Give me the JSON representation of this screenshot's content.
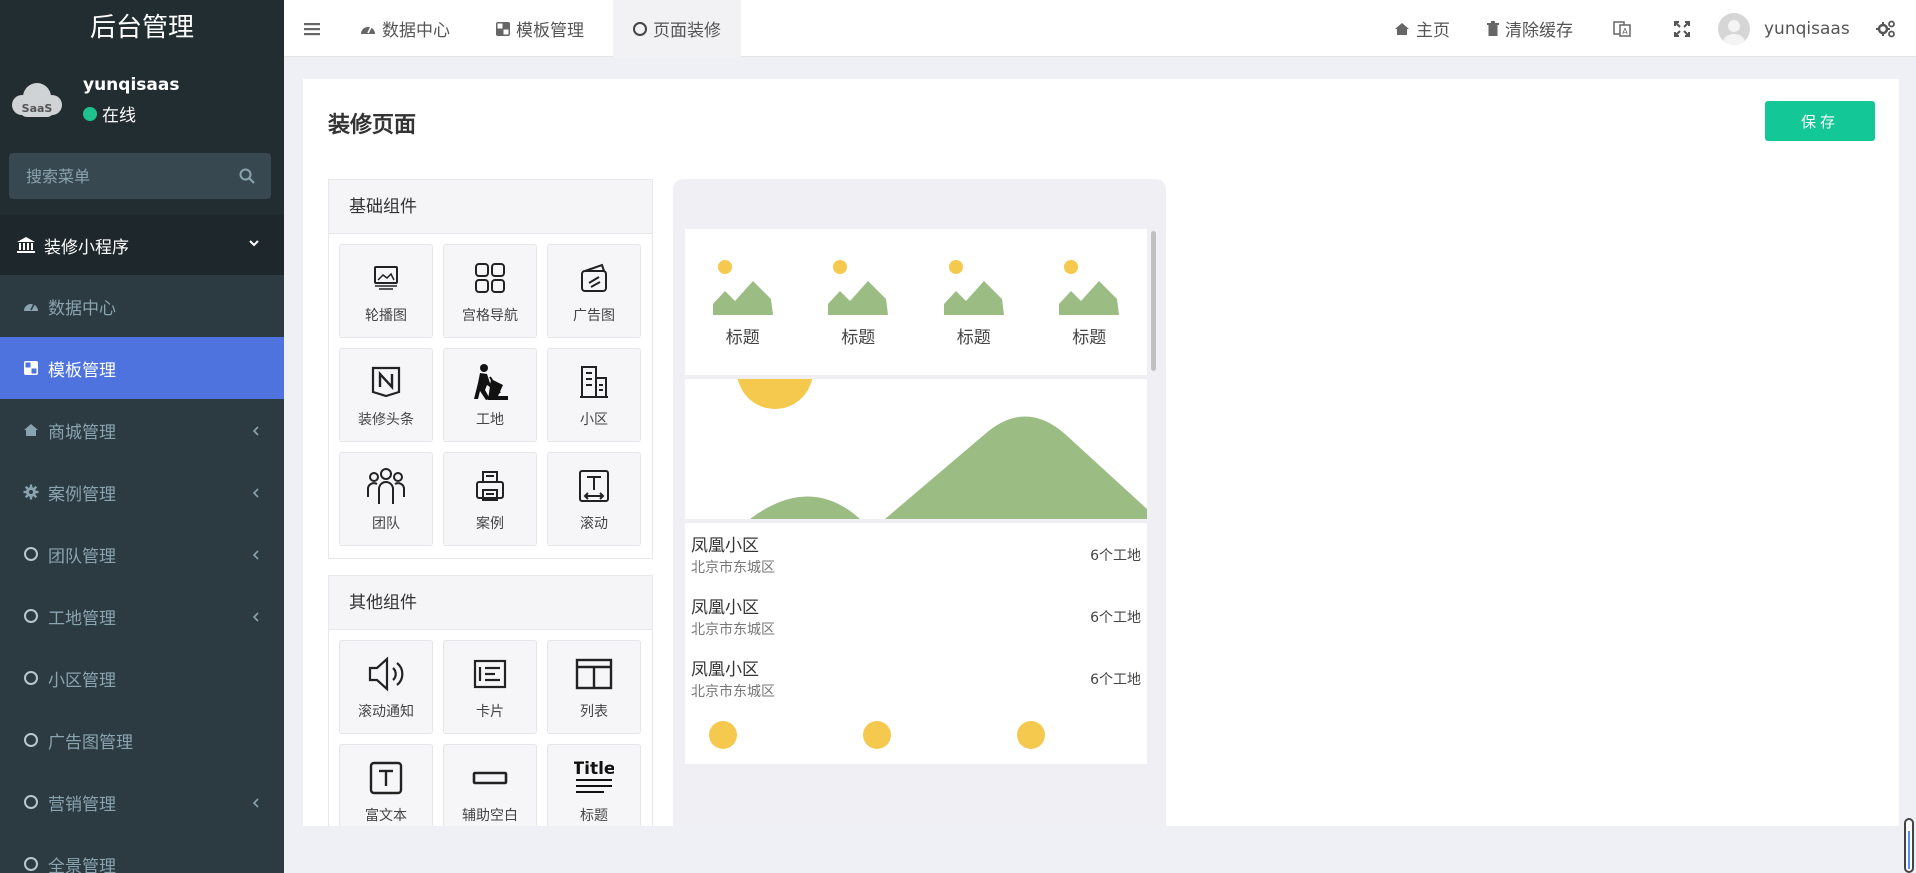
{
  "sidebar": {
    "logo": "后台管理",
    "avatar_text": "SaaS",
    "username": "yunqisaas",
    "status": "在线",
    "search_placeholder": "搜索菜单",
    "section": "装修小程序",
    "items": [
      {
        "label": "数据中心",
        "icon": "dashboard-icon",
        "active": false,
        "arrow": false
      },
      {
        "label": "模板管理",
        "icon": "template-icon",
        "active": true,
        "arrow": false
      },
      {
        "label": "商城管理",
        "icon": "home-icon",
        "active": false,
        "arrow": true
      },
      {
        "label": "案例管理",
        "icon": "gear-icon",
        "active": false,
        "arrow": true
      },
      {
        "label": "团队管理",
        "icon": "circle-icon",
        "active": false,
        "arrow": true
      },
      {
        "label": "工地管理",
        "icon": "circle-icon",
        "active": false,
        "arrow": true
      },
      {
        "label": "小区管理",
        "icon": "circle-icon",
        "active": false,
        "arrow": false
      },
      {
        "label": "广告图管理",
        "icon": "circle-icon",
        "active": false,
        "arrow": false
      },
      {
        "label": "营销管理",
        "icon": "circle-icon",
        "active": false,
        "arrow": true
      },
      {
        "label": "全景管理",
        "icon": "circle-icon",
        "active": false,
        "arrow": false
      }
    ]
  },
  "topbar": {
    "tabs": [
      "数据中心",
      "模板管理",
      "页面装修"
    ],
    "active_tab": "页面装修",
    "home": "主页",
    "clear_cache": "清除缓存",
    "username": "yunqisaas"
  },
  "page": {
    "title": "装修页面",
    "save": "保存"
  },
  "basic_components": {
    "title": "基础组件",
    "items": [
      "轮播图",
      "宫格导航",
      "广告图",
      "装修头条",
      "工地",
      "小区",
      "团队",
      "案例",
      "滚动"
    ]
  },
  "other_components": {
    "title": "其他组件",
    "items": [
      "滚动通知",
      "卡片",
      "列表",
      "富文本",
      "辅助空白",
      "标题"
    ]
  },
  "preview": {
    "nav_items": [
      "标题",
      "标题",
      "标题",
      "标题"
    ],
    "list": [
      {
        "name": "凤凰小区",
        "addr": "北京市东城区",
        "count": "6个工地"
      },
      {
        "name": "凤凰小区",
        "addr": "北京市东城区",
        "count": "6个工地"
      },
      {
        "name": "凤凰小区",
        "addr": "北京市东城区",
        "count": "6个工地"
      }
    ],
    "title_icon_text": "Title"
  },
  "colors": {
    "sidebar_bg": "#222d32",
    "active_item": "#4e73df",
    "save_button": "#13c796",
    "online_dot": "#1fc18f",
    "mountain": "#9bbd84",
    "sun": "#f5c94e"
  }
}
